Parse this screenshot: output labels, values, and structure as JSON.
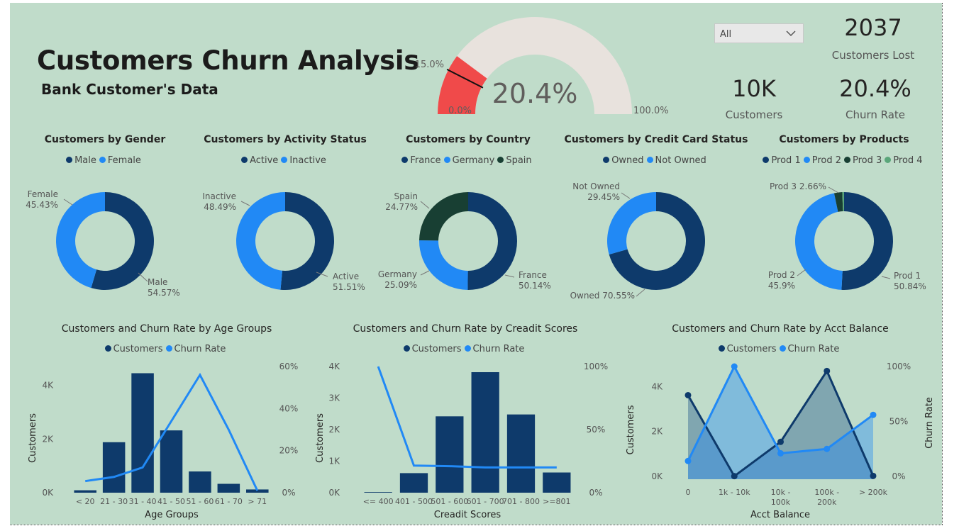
{
  "header": {
    "title": "Customers Churn Analysis",
    "subtitle": "Bank Customer's Data"
  },
  "gauge": {
    "value_label": "20.4%",
    "min_label": "0.0%",
    "max_label": "100.0%",
    "target_label": "15.0%",
    "value": 20.4,
    "target": 15.0,
    "min": 0,
    "max": 100,
    "fill_color": "#f04a4a",
    "track_color": "#e8e2dd"
  },
  "slicer": {
    "selected": "All",
    "icon": "chevron-down-icon"
  },
  "kpis": {
    "customers_lost": {
      "value": "2037",
      "label": "Customers Lost"
    },
    "customers": {
      "value": "10K",
      "label": "Customers"
    },
    "churn_rate": {
      "value": "20.4%",
      "label": "Churn Rate"
    }
  },
  "colors": {
    "dark": "#0e3a6b",
    "light": "#2189f5",
    "darkgreen": "#183f33",
    "green": "#5aa67a"
  },
  "chart_data": [
    {
      "type": "pie",
      "title": "Customers by Gender",
      "legend": [
        "Male",
        "Female"
      ],
      "slices": [
        {
          "name": "Male",
          "value": 54.57,
          "label": "Male\n54.57%"
        },
        {
          "name": "Female",
          "value": 45.43,
          "label": "Female\n45.43%"
        }
      ]
    },
    {
      "type": "pie",
      "title": "Customers by Activity Status",
      "legend": [
        "Active",
        "Inactive"
      ],
      "slices": [
        {
          "name": "Active",
          "value": 51.51,
          "label": "Active\n51.51%"
        },
        {
          "name": "Inactive",
          "value": 48.49,
          "label": "Inactive\n48.49%"
        }
      ]
    },
    {
      "type": "pie",
      "title": "Customers by Country",
      "legend": [
        "France",
        "Germany",
        "Spain"
      ],
      "slices": [
        {
          "name": "France",
          "value": 50.14,
          "label": "France\n50.14%"
        },
        {
          "name": "Germany",
          "value": 25.09,
          "label": "Germany\n25.09%"
        },
        {
          "name": "Spain",
          "value": 24.77,
          "label": "Spain\n24.77%"
        }
      ]
    },
    {
      "type": "pie",
      "title": "Customers by Credit Card Status",
      "legend": [
        "Owned",
        "Not Owned"
      ],
      "slices": [
        {
          "name": "Owned",
          "value": 70.55,
          "label": "Owned 70.55%"
        },
        {
          "name": "Not Owned",
          "value": 29.45,
          "label": "Not Owned\n29.45%"
        }
      ]
    },
    {
      "type": "pie",
      "title": "Customers by Products",
      "legend": [
        "Prod 1",
        "Prod 2",
        "Prod 3",
        "Prod 4"
      ],
      "slices": [
        {
          "name": "Prod 1",
          "value": 50.84,
          "label": "Prod 1\n50.84%"
        },
        {
          "name": "Prod 2",
          "value": 45.9,
          "label": "Prod 2\n45.9%"
        },
        {
          "name": "Prod 3",
          "value": 2.66,
          "label": "Prod 3 2.66%"
        },
        {
          "name": "Prod 4",
          "value": 0.6,
          "label": ""
        }
      ]
    },
    {
      "type": "bar",
      "title": "Customers and Churn Rate by Age Groups",
      "legend": [
        "Customers",
        "Churn Rate"
      ],
      "xlabel": "Age Groups",
      "ylabel": "Customers",
      "categories": [
        "< 20",
        "21 - 30",
        "31 - 40",
        "41 - 50",
        "51 - 60",
        "61 - 70",
        "> 71"
      ],
      "series": [
        {
          "name": "Customers",
          "kind": "bar",
          "values": [
            90,
            1880,
            4450,
            2320,
            790,
            330,
            120
          ]
        },
        {
          "name": "Churn Rate",
          "kind": "line",
          "values": [
            5.5,
            7.5,
            12,
            34,
            56,
            30,
            1
          ]
        }
      ],
      "ylim": [
        0,
        4700
      ],
      "y2lim": [
        0,
        60
      ],
      "yticks": [
        "0K",
        "2K",
        "4K"
      ],
      "yticks_v": [
        0,
        2000,
        4000
      ],
      "y2ticks": [
        "0%",
        "20%",
        "40%",
        "60%"
      ],
      "y2ticks_v": [
        0,
        20,
        40,
        60
      ]
    },
    {
      "type": "bar",
      "title": "Customers and Churn Rate by Creadit Scores",
      "legend": [
        "Customers",
        "Churn Rate"
      ],
      "xlabel": "Creadit Scores",
      "ylabel": "Customers",
      "categories": [
        "<= 400",
        "401 - 500",
        "501 - 600",
        "601 - 700",
        "701 - 800",
        ">=801"
      ],
      "series": [
        {
          "name": "Customers",
          "kind": "bar",
          "values": [
            20,
            620,
            2420,
            3820,
            2480,
            640
          ]
        },
        {
          "name": "Churn Rate",
          "kind": "line",
          "values": [
            100,
            21.5,
            21,
            20,
            20,
            20
          ]
        }
      ],
      "ylim": [
        0,
        4000
      ],
      "y2lim": [
        0,
        100
      ],
      "yticks": [
        "0K",
        "1K",
        "2K",
        "3K",
        "4K"
      ],
      "yticks_v": [
        0,
        1000,
        2000,
        3000,
        4000
      ],
      "y2ticks": [
        "0%",
        "50%",
        "100%"
      ],
      "y2ticks_v": [
        0,
        50,
        100
      ]
    },
    {
      "type": "area",
      "title": "Customers and Churn Rate by Acct Balance",
      "legend": [
        "Customers",
        "Churn Rate"
      ],
      "xlabel": "Acct Balance",
      "ylabel": "Customers",
      "y2label": "Churn Rate",
      "categories": [
        "0",
        "1k - 10k",
        "10k - 100k",
        "100k - 200k",
        "> 200k"
      ],
      "series": [
        {
          "name": "Customers",
          "values": [
            3620,
            10,
            1540,
            4700,
            20
          ]
        },
        {
          "name": "Churn Rate",
          "values": [
            14,
            100,
            21,
            25,
            56
          ]
        }
      ],
      "ylim": [
        0,
        4900
      ],
      "y2lim": [
        0,
        100
      ],
      "yticks": [
        "0K",
        "2K",
        "4K"
      ],
      "yticks_v": [
        0,
        2000,
        4000
      ],
      "y2ticks": [
        "0%",
        "50%",
        "100%"
      ],
      "y2ticks_v": [
        0,
        50,
        100
      ]
    }
  ]
}
